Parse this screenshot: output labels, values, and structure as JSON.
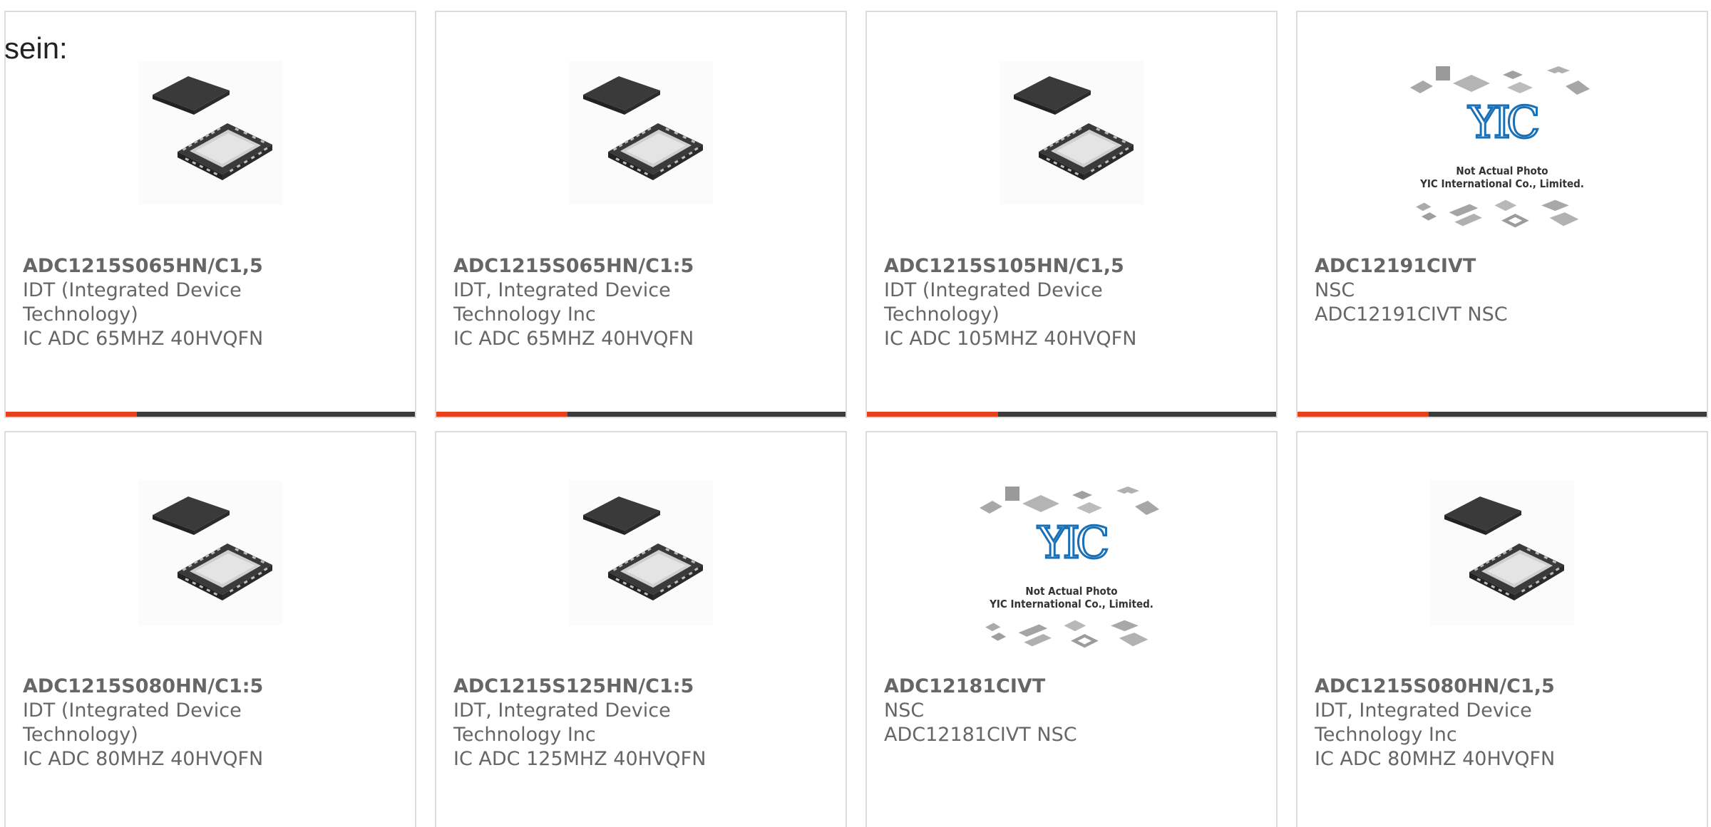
{
  "intro_text": "sein:",
  "colors": {
    "card_border": "#dcdcdc",
    "text": "#666666",
    "accent_bar": "#e8401c",
    "bar_dark": "#3b3b3b"
  },
  "yic_image": {
    "logo_text": "YIC",
    "caption_line1": "Not Actual Photo",
    "caption_line2": "YIC International Co., Limited."
  },
  "products": [
    {
      "part_number": "ADC1215S065HN/C1,5",
      "manufacturer": "IDT (Integrated Device Technology)",
      "description": "IC ADC 65MHZ 40HVQFN",
      "image": "qfn-chip-image"
    },
    {
      "part_number": "ADC1215S065HN/C1:5",
      "manufacturer": "IDT, Integrated Device Technology Inc",
      "description": "IC ADC 65MHZ 40HVQFN",
      "image": "qfn-chip-image"
    },
    {
      "part_number": "ADC1215S105HN/C1,5",
      "manufacturer": "IDT (Integrated Device Technology)",
      "description": "IC ADC 105MHZ 40HVQFN",
      "image": "qfn-chip-image"
    },
    {
      "part_number": "ADC12191CIVT",
      "manufacturer": "NSC",
      "description": "ADC12191CIVT NSC",
      "image": "yic-placeholder-image"
    },
    {
      "part_number": "ADC1215S080HN/C1:5",
      "manufacturer": "IDT (Integrated Device Technology)",
      "description": "IC ADC 80MHZ 40HVQFN",
      "image": "qfn-chip-image"
    },
    {
      "part_number": "ADC1215S125HN/C1:5",
      "manufacturer": "IDT, Integrated Device Technology Inc",
      "description": "IC ADC 125MHZ 40HVQFN",
      "image": "qfn-chip-image"
    },
    {
      "part_number": "ADC12181CIVT",
      "manufacturer": "NSC",
      "description": "ADC12181CIVT NSC",
      "image": "yic-placeholder-image"
    },
    {
      "part_number": "ADC1215S080HN/C1,5",
      "manufacturer": "IDT, Integrated Device Technology Inc",
      "description": "IC ADC 80MHZ 40HVQFN",
      "image": "qfn-chip-image"
    }
  ]
}
